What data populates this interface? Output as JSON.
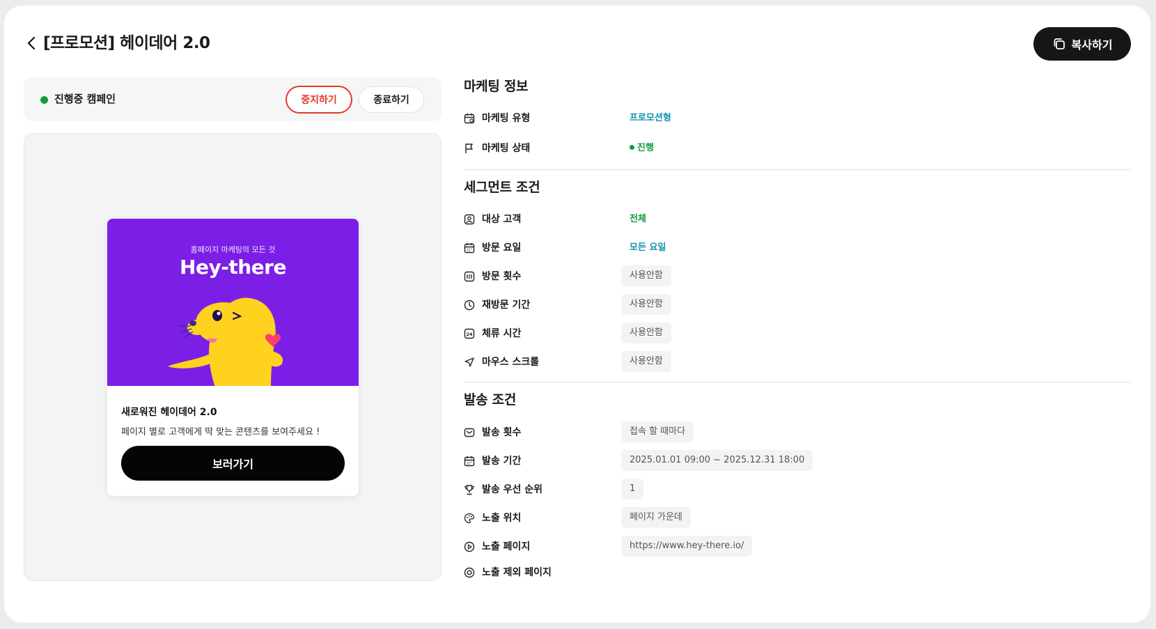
{
  "header": {
    "title": "[프로모션] 헤이데어 2.0",
    "copy_label": "복사하기"
  },
  "status": {
    "text": "진행중 캠페인",
    "stop_label": "중지하기",
    "end_label": "종료하기",
    "dot_color": "#129b3b"
  },
  "preview": {
    "banner_sub": "홈페이지 마케팅의 모든 것",
    "banner_logo": "Hey-there",
    "title": "새로워진 헤이데어 2.0",
    "description": "페이지 별로 고객에게 딱 맞는 콘텐츠를 보여주세요 !",
    "cta_label": "보러가기",
    "banner_color": "#7b1fe6",
    "mascot_icon": "yellow-seal-mascot"
  },
  "marketing": {
    "title": "마케팅 정보",
    "type_label": "마케팅 유형",
    "type_value": "프로모션형",
    "state_label": "마케팅 상태",
    "state_value": "진행"
  },
  "segment": {
    "title": "세그먼트 조건",
    "target_label": "대상 고객",
    "target_value": "전체",
    "visit_day_label": "방문 요일",
    "visit_day_value": "모든 요일",
    "visit_count_label": "방문 횟수",
    "visit_count_value": "사용안함",
    "revisit_label": "재방문 기간",
    "revisit_value": "사용안함",
    "stay_label": "체류 시간",
    "stay_value": "사용안함",
    "scroll_label": "마우스 스크롤",
    "scroll_value": "사용안함"
  },
  "dispatch": {
    "title": "발송 조건",
    "count_label": "발송 횟수",
    "count_value": "접속 할 때마다",
    "period_label": "발송 기간",
    "period_value": "2025.01.01 09:00 ~ 2025.12.31 18:00",
    "priority_label": "발송 우선 순위",
    "priority_value": "1",
    "position_label": "노출 위치",
    "position_value": "페이지 가운데",
    "page_label": "노출 페이지",
    "page_value": "https://www.hey-there.io/",
    "exclude_label": "노출 제외 페이지"
  },
  "colors": {
    "accent_red": "#e5352b",
    "teal_value": "#0f8fb0",
    "green_value": "#129b3b"
  }
}
